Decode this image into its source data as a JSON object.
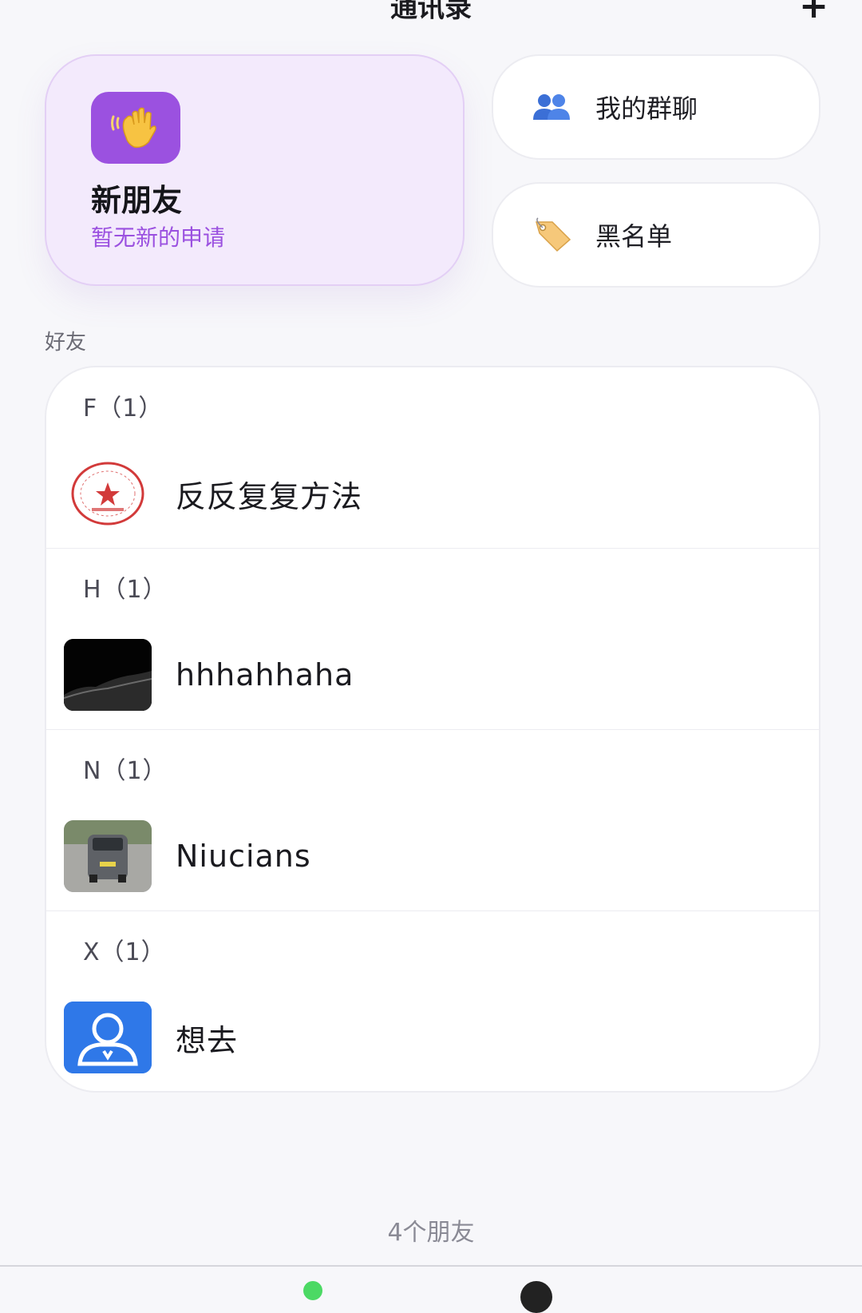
{
  "header": {
    "title": "通讯录",
    "add_label": "+"
  },
  "new_friends": {
    "title": "新朋友",
    "subtitle": "暂无新的申请",
    "icon": "waving-hand-icon"
  },
  "side_cards": [
    {
      "label": "我的群聊",
      "icon": "group-users-icon"
    },
    {
      "label": "黑名单",
      "icon": "tag-label-icon"
    }
  ],
  "section_label": "好友",
  "groups": [
    {
      "letter": "F（1）",
      "name": "反反复复方法",
      "avatar": "red-seal-avatar"
    },
    {
      "letter": "H（1）",
      "name": "hhhahhaha",
      "avatar": "dark-landscape-avatar"
    },
    {
      "letter": "N（1）",
      "name": "Niucians",
      "avatar": "car-photo-avatar"
    },
    {
      "letter": "X（1）",
      "name": "想去",
      "avatar": "default-person-avatar"
    }
  ],
  "footer": {
    "count_text": "4个朋友"
  },
  "colors": {
    "accent": "#9b51e0",
    "background": "#f7f7fa",
    "card": "#ffffff"
  }
}
